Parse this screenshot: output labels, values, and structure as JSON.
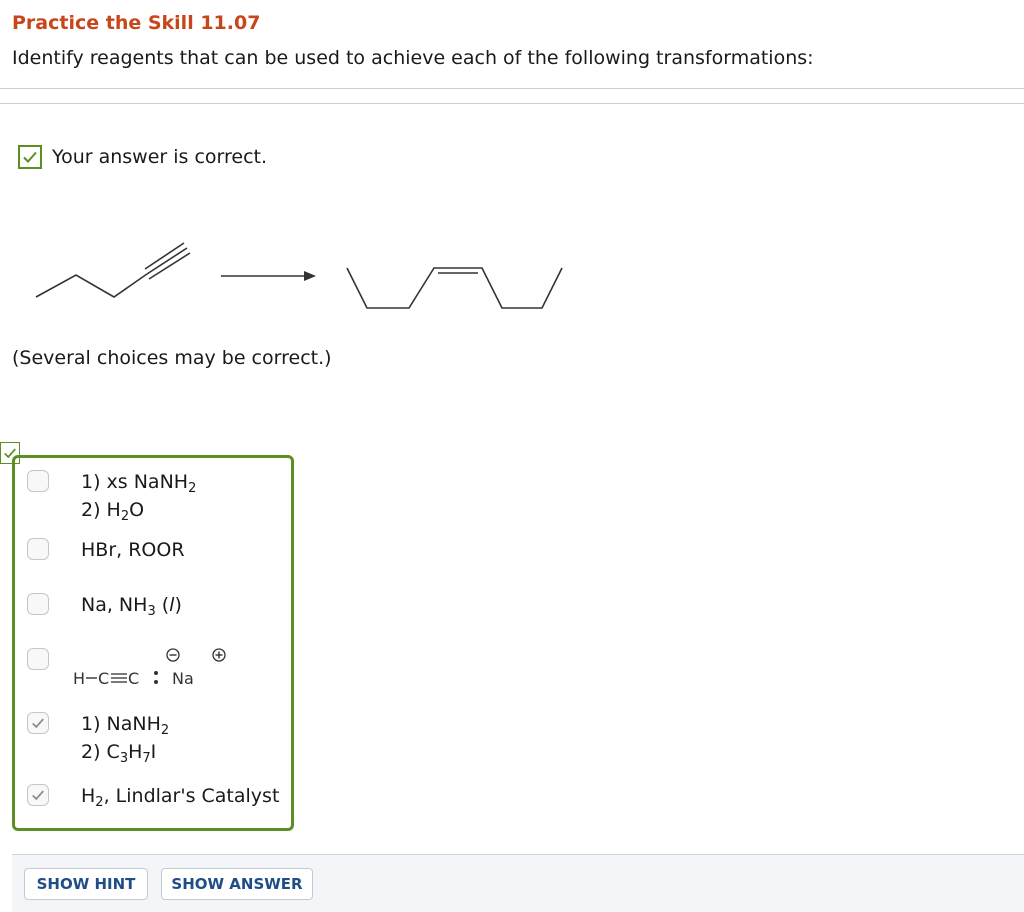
{
  "header": {
    "title": "Practice the Skill 11.07",
    "prompt": "Identify reagents that can be used to achieve each of the following transformations:"
  },
  "feedback": {
    "text": "Your answer is correct."
  },
  "instructions": {
    "note": "(Several choices may be correct.)"
  },
  "choices": [
    {
      "lines": [
        {
          "pre": "1) xs NaNH",
          "sub": "2",
          "post": ""
        },
        {
          "pre": "2) H",
          "sub": "2",
          "post": "O"
        }
      ],
      "checked": false
    },
    {
      "lines": [
        {
          "pre": "HBr, ROOR",
          "sub": "",
          "post": ""
        }
      ],
      "checked": false
    },
    {
      "lines": [
        {
          "pre": "Na, NH",
          "sub": "3",
          "post": " (l)"
        }
      ],
      "checked": false
    },
    {
      "structure": {
        "h": "H",
        "c1": "C",
        "c2": "C",
        "na": "Na",
        "neg": "−",
        "pos": "+"
      },
      "checked": false
    },
    {
      "lines": [
        {
          "pre": "1) NaNH",
          "sub": "2",
          "post": ""
        },
        {
          "pre": "2) C",
          "sub": "3",
          "post": "H",
          "sub2": "7",
          "post2": "I"
        }
      ],
      "checked": true
    },
    {
      "lines": [
        {
          "pre": "H",
          "sub": "2",
          "post": ", Lindlar's Catalyst"
        }
      ],
      "checked": true
    }
  ],
  "buttons": {
    "hint": "SHOW HINT",
    "answer": "SHOW ANSWER"
  },
  "colors": {
    "title": "#c8461b",
    "correct": "#5b8f22",
    "button_text": "#1f4e86"
  }
}
